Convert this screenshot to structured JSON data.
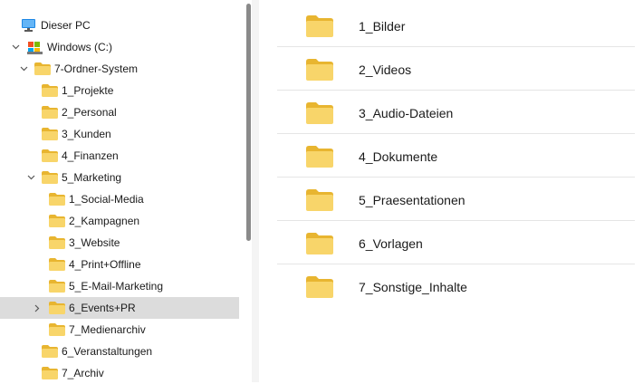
{
  "tree": {
    "this_pc": "Dieser PC",
    "drive": "Windows (C:)",
    "root_folder": "7-Ordner-System",
    "items": [
      {
        "label": "1_Projekte"
      },
      {
        "label": "2_Personal"
      },
      {
        "label": "3_Kunden"
      },
      {
        "label": "4_Finanzen"
      },
      {
        "label": "5_Marketing"
      },
      {
        "label": "1_Social-Media"
      },
      {
        "label": "2_Kampagnen"
      },
      {
        "label": "3_Website"
      },
      {
        "label": "4_Print+Offline"
      },
      {
        "label": "5_E-Mail-Marketing"
      },
      {
        "label": "6_Events+PR"
      },
      {
        "label": "7_Medienarchiv"
      },
      {
        "label": "6_Veranstaltungen"
      },
      {
        "label": "7_Archiv"
      }
    ],
    "selected": "6_Events+PR"
  },
  "content": {
    "folders": [
      {
        "label": "1_Bilder"
      },
      {
        "label": "2_Videos"
      },
      {
        "label": "3_Audio-Dateien"
      },
      {
        "label": "4_Dokumente"
      },
      {
        "label": "5_Praesentationen"
      },
      {
        "label": "6_Vorlagen"
      },
      {
        "label": "7_Sonstige_Inhalte"
      }
    ]
  },
  "colors": {
    "folder_body": "#f8d56a",
    "folder_tab": "#e8b530",
    "selected_bg": "#dcdcdc",
    "pc_icon": "#1e88e5"
  }
}
